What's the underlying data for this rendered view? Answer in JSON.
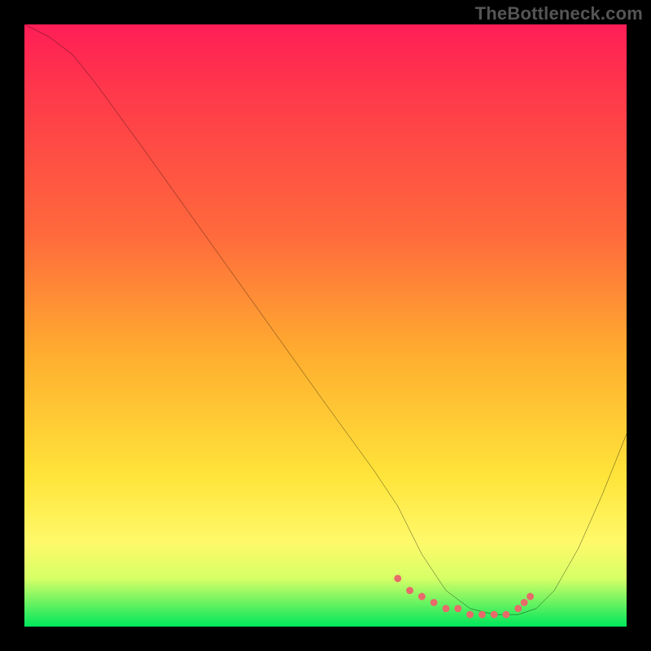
{
  "watermark": "TheBottleneck.com",
  "chart_data": {
    "type": "line",
    "title": "",
    "xlabel": "",
    "ylabel": "",
    "xlim": [
      0,
      100
    ],
    "ylim": [
      0,
      100
    ],
    "gradient_stops": [
      {
        "pos": 0,
        "color": "#ff1e56"
      },
      {
        "pos": 12,
        "color": "#ff3a4a"
      },
      {
        "pos": 35,
        "color": "#ff6a3c"
      },
      {
        "pos": 55,
        "color": "#ffae2f"
      },
      {
        "pos": 75,
        "color": "#ffe43a"
      },
      {
        "pos": 86,
        "color": "#fff96a"
      },
      {
        "pos": 92,
        "color": "#d6ff66"
      },
      {
        "pos": 100,
        "color": "#00e65c"
      }
    ],
    "series": [
      {
        "name": "curve",
        "color": "#000000",
        "x": [
          0,
          4,
          8,
          12,
          20,
          30,
          40,
          50,
          58,
          62,
          66,
          70,
          74,
          78,
          82,
          85,
          88,
          92,
          96,
          100
        ],
        "y": [
          100,
          98,
          95,
          90,
          79,
          65,
          51,
          37,
          26,
          20,
          12,
          6,
          3,
          2,
          2,
          3,
          6,
          13,
          22,
          32
        ]
      }
    ],
    "highlight_points": {
      "name": "dots",
      "color": "#e86a6a",
      "x": [
        62,
        64,
        66,
        68,
        70,
        72,
        74,
        76,
        78,
        80,
        82,
        83,
        84
      ],
      "y": [
        8,
        6,
        5,
        4,
        3,
        3,
        2,
        2,
        2,
        2,
        3,
        4,
        5
      ]
    }
  }
}
